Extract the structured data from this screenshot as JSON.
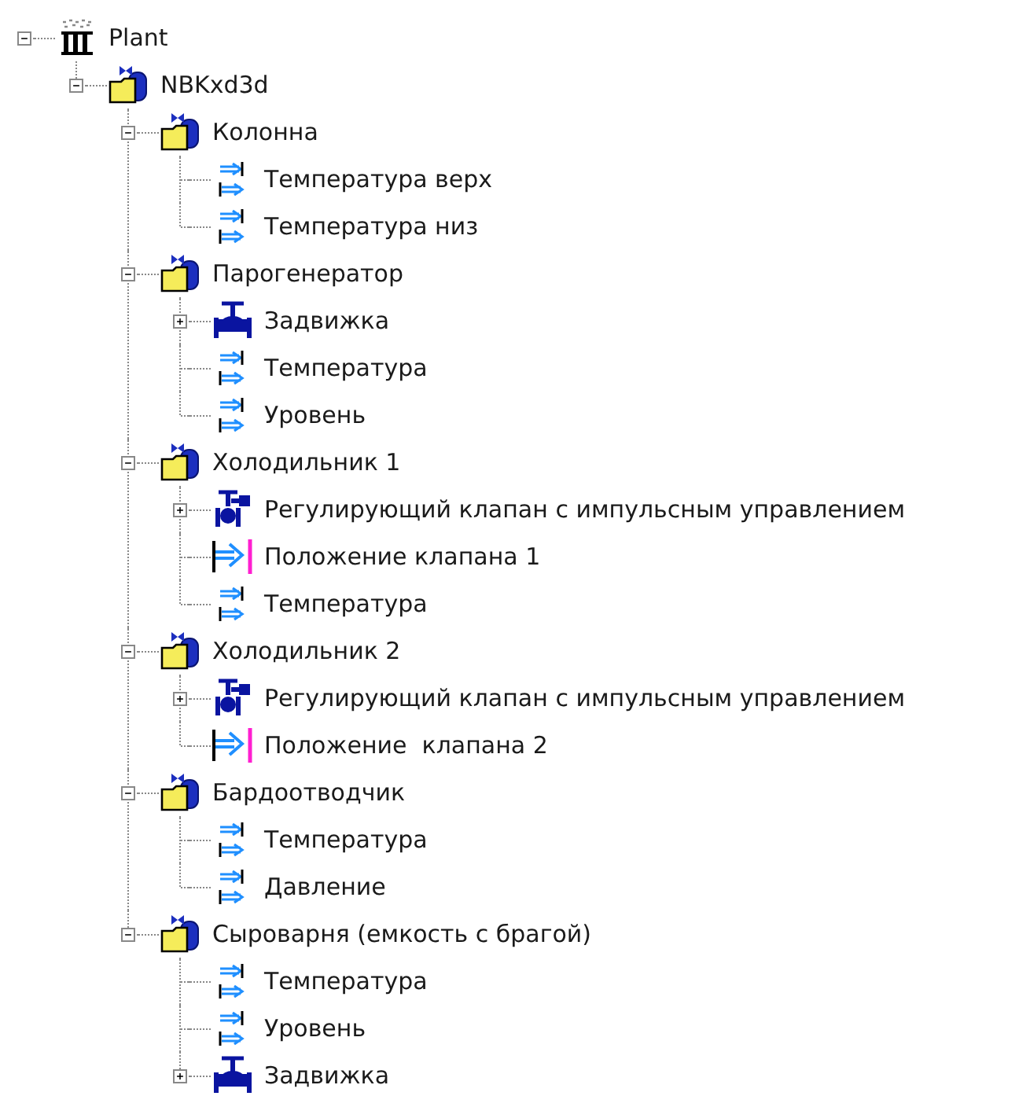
{
  "tree": [
    {
      "label": "Plant",
      "kind": "plant",
      "expanded": true,
      "children": [
        {
          "label": "NBKxd3d",
          "kind": "folder",
          "expanded": true,
          "children": [
            {
              "label": "Колонна",
              "kind": "folder",
              "expanded": true,
              "children": [
                {
                  "label": "Температура верх",
                  "kind": "sensor"
                },
                {
                  "label": "Температура низ",
                  "kind": "sensor"
                }
              ]
            },
            {
              "label": "Парогенератор",
              "kind": "folder",
              "expanded": true,
              "children": [
                {
                  "label": "Задвижка",
                  "kind": "valve",
                  "expanded": false
                },
                {
                  "label": "Температура",
                  "kind": "sensor"
                },
                {
                  "label": "Уровень",
                  "kind": "sensor"
                }
              ]
            },
            {
              "label": "Холодильник 1",
              "kind": "folder",
              "expanded": true,
              "children": [
                {
                  "label": "Регулирующий клапан с импульсным управлением",
                  "kind": "control-valve",
                  "expanded": false
                },
                {
                  "label": "Положение клапана 1",
                  "kind": "position"
                },
                {
                  "label": "Температура",
                  "kind": "sensor"
                }
              ]
            },
            {
              "label": "Холодильник 2",
              "kind": "folder",
              "expanded": true,
              "children": [
                {
                  "label": "Регулирующий клапан с импульсным управлением",
                  "kind": "control-valve",
                  "expanded": false
                },
                {
                  "label": "Положение  клапана 2",
                  "kind": "position"
                }
              ]
            },
            {
              "label": "Бардоотводчик",
              "kind": "folder",
              "expanded": true,
              "children": [
                {
                  "label": "Температура",
                  "kind": "sensor"
                },
                {
                  "label": "Давление",
                  "kind": "sensor"
                }
              ]
            },
            {
              "label": "Сыроварня (емкость с брагой)",
              "kind": "folder",
              "expanded": true,
              "children": [
                {
                  "label": "Температура",
                  "kind": "sensor"
                },
                {
                  "label": "Уровень",
                  "kind": "sensor"
                },
                {
                  "label": "Задвижка",
                  "kind": "valve",
                  "expanded": false
                }
              ]
            }
          ]
        }
      ]
    }
  ]
}
